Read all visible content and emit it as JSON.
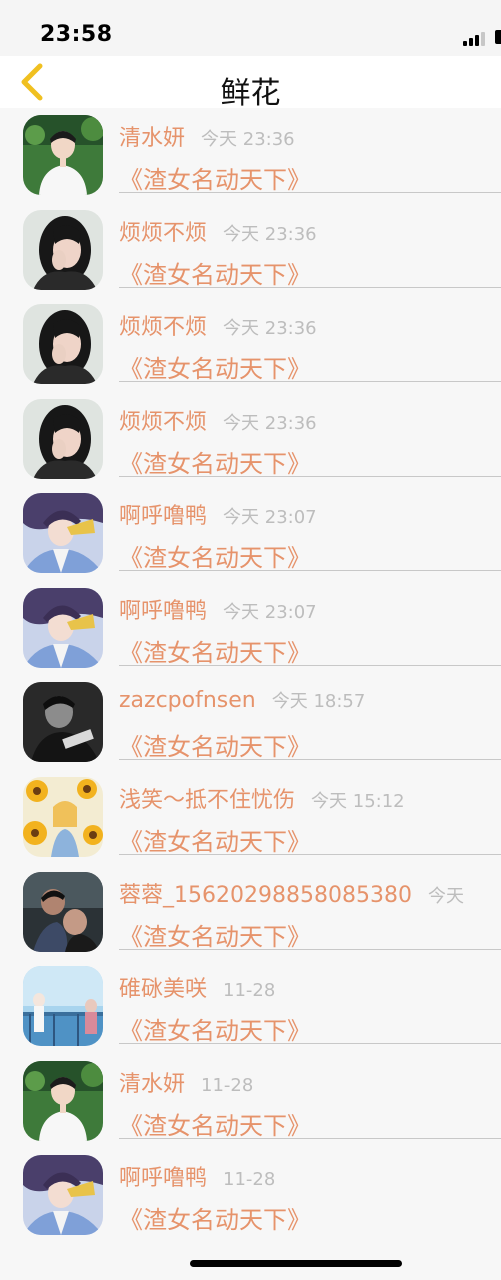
{
  "status_bar": {
    "time": "23:58"
  },
  "nav": {
    "title": "鲜花",
    "back_icon": "chevron-left-icon",
    "accent_color": "#f0c020"
  },
  "colors": {
    "name": "#e6936b",
    "timestamp": "#bdbdbd",
    "divider": "#c8c8c8",
    "background": "#f7f7f7"
  },
  "records": [
    {
      "name": "清水妍",
      "time": "今天 23:36",
      "gift": "《渣女名动天下》",
      "avatar": "boy-white-shirt"
    },
    {
      "name": "烦烦不烦",
      "time": "今天 23:36",
      "gift": "《渣女名动天下》",
      "avatar": "girl-dark-hair"
    },
    {
      "name": "烦烦不烦",
      "time": "今天 23:36",
      "gift": "《渣女名动天下》",
      "avatar": "girl-dark-hair"
    },
    {
      "name": "烦烦不烦",
      "time": "今天 23:36",
      "gift": "《渣女名动天下》",
      "avatar": "girl-dark-hair"
    },
    {
      "name": "啊呼噜鸭",
      "time": "今天 23:07",
      "gift": "《渣女名动天下》",
      "avatar": "anime-boy"
    },
    {
      "name": "啊呼噜鸭",
      "time": "今天 23:07",
      "gift": "《渣女名动天下》",
      "avatar": "anime-boy"
    },
    {
      "name": "zazcpofnsen",
      "time": "今天 18:57",
      "gift": "《渣女名动天下》",
      "avatar": "monochrome-boy"
    },
    {
      "name": "浅笑～抵不住忧伤",
      "time": "今天 15:12",
      "gift": "《渣女名动天下》",
      "avatar": "sunflowers"
    },
    {
      "name": "蓉蓉_1562029885808538​0",
      "time": "今天",
      "gift": "《渣女名动天下》",
      "avatar": "dark-photo"
    },
    {
      "name": "碓砯美咲",
      "time": "11-28",
      "gift": "《渣女名动天下》",
      "avatar": "blue-sky"
    },
    {
      "name": "清水妍",
      "time": "11-28",
      "gift": "《渣女名动天下》",
      "avatar": "boy-white-shirt"
    },
    {
      "name": "啊呼噜鸭",
      "time": "11-28",
      "gift": "《渣女名动天下》",
      "avatar": "anime-boy"
    }
  ]
}
